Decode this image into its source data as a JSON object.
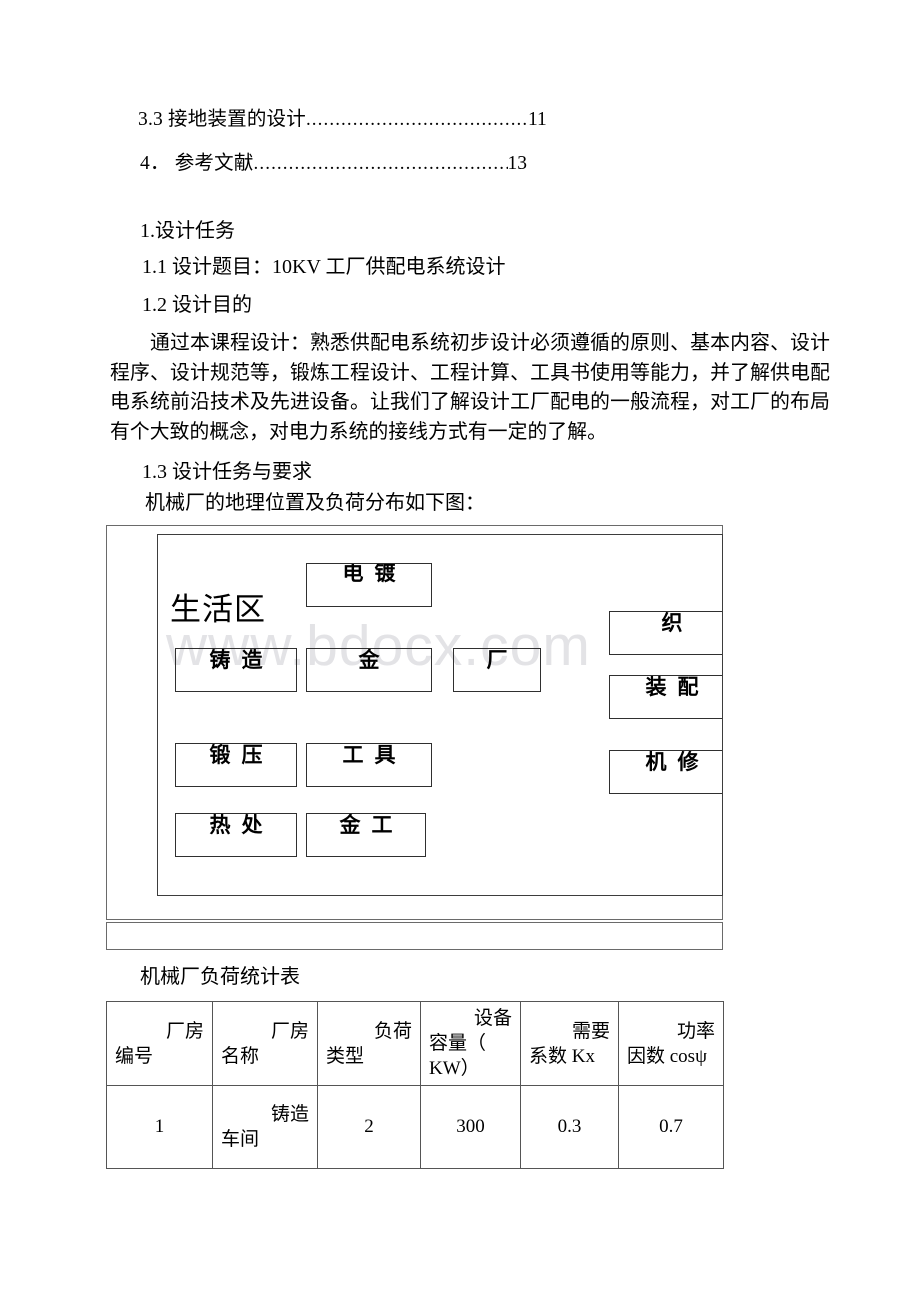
{
  "toc": {
    "entries": [
      {
        "label": "3.3 接地装置的设计",
        "dots": "..............................................",
        "page": "11"
      },
      {
        "label": "4． 参考文献",
        "dots": "..................................................",
        "page": "13"
      }
    ]
  },
  "headings": {
    "section_1": "1.设计任务",
    "section_1_1": "1.1 设计题目：10KV 工厂供配电系统设计",
    "section_1_2": "1.2 设计目的",
    "section_1_3": "1.3 设计任务与要求"
  },
  "paragraphs": {
    "purpose": "通过本课程设计：熟悉供配电系统初步设计必须遵循的原则、基本内容、设计程序、设计规范等，锻炼工程设计、工程计算、工具书使用等能力，并了解供电配电系统前沿技术及先进设备。让我们了解设计工厂配电的一般流程，对工厂的布局有个大致的概念，对电力系统的接线方式有一定的了解。",
    "figure_intro": "机械厂的地理位置及负荷分布如下图："
  },
  "figure": {
    "watermark": "www.bdocx.com",
    "zone_label": "生活区",
    "boxes": [
      {
        "name": "electroplating",
        "text": "电镀"
      },
      {
        "name": "casting",
        "text": "铸造"
      },
      {
        "name": "assembly-hall",
        "text": "金"
      },
      {
        "name": "factory",
        "text": "厂"
      },
      {
        "name": "weaving",
        "text": "织"
      },
      {
        "name": "forging",
        "text": "锻压"
      },
      {
        "name": "tooling",
        "text": "工具"
      },
      {
        "name": "fitting",
        "text": "装配"
      },
      {
        "name": "heat-treatment",
        "text": "热处"
      },
      {
        "name": "metalwork",
        "text": "金工"
      },
      {
        "name": "machine-repair",
        "text": "机修"
      }
    ]
  },
  "table": {
    "caption": "机械厂负荷统计表",
    "headers": [
      {
        "l1": "厂房",
        "l2": "编号",
        "l3": ""
      },
      {
        "l1": "厂房",
        "l2": "名称",
        "l3": ""
      },
      {
        "l1": "负荷",
        "l2": "类型",
        "l3": ""
      },
      {
        "l1": "设备",
        "l2": "容量（",
        "l3": "KW）"
      },
      {
        "l1": "需要",
        "l2": "系数 Kx",
        "l3": ""
      },
      {
        "l1": "功率",
        "l2": "因数 cosψ",
        "l3": ""
      }
    ],
    "rows": [
      {
        "number": "1",
        "name_l1": "铸造",
        "name_l2": "车间",
        "load_type": "2",
        "capacity": "300",
        "demand_factor": "0.3",
        "power_factor": "0.7"
      }
    ]
  }
}
